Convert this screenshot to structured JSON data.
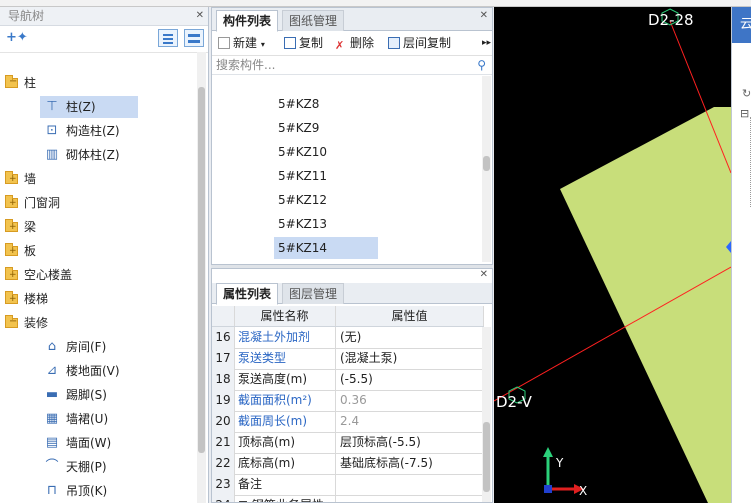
{
  "nav": {
    "title": "导航树",
    "add_icon": "plus-star-icon",
    "items": [
      {
        "label": "柱",
        "type": "folder-open"
      },
      {
        "label": "柱(Z)",
        "type": "child",
        "icon": "column-icon",
        "selected": true
      },
      {
        "label": "构造柱(Z)",
        "type": "child",
        "icon": "constructional-column-icon"
      },
      {
        "label": "砌体柱(Z)",
        "type": "child",
        "icon": "masonry-column-icon"
      },
      {
        "label": "墙",
        "type": "folder"
      },
      {
        "label": "门窗洞",
        "type": "folder"
      },
      {
        "label": "梁",
        "type": "folder"
      },
      {
        "label": "板",
        "type": "folder"
      },
      {
        "label": "空心楼盖",
        "type": "folder"
      },
      {
        "label": "楼梯",
        "type": "folder"
      },
      {
        "label": "装修",
        "type": "folder-open"
      },
      {
        "label": "房间(F)",
        "type": "child",
        "icon": "room-icon"
      },
      {
        "label": "楼地面(V)",
        "type": "child",
        "icon": "floor-icon"
      },
      {
        "label": "踢脚(S)",
        "type": "child",
        "icon": "skirting-icon"
      },
      {
        "label": "墙裙(U)",
        "type": "child",
        "icon": "dado-icon"
      },
      {
        "label": "墙面(W)",
        "type": "child",
        "icon": "wall-face-icon"
      },
      {
        "label": "天棚(P)",
        "type": "child",
        "icon": "ceiling-icon"
      },
      {
        "label": "吊顶(K)",
        "type": "child",
        "icon": "suspended-ceiling-icon"
      }
    ]
  },
  "components": {
    "tabs": [
      "构件列表",
      "图纸管理"
    ],
    "toolbar": {
      "new": "新建",
      "copy": "复制",
      "delete": "删除",
      "floor_copy": "层间复制"
    },
    "search_placeholder": "搜索构件...",
    "items": [
      "5#KZ8",
      "5#KZ9",
      "5#KZ10",
      "5#KZ11",
      "5#KZ12",
      "5#KZ13",
      "5#KZ14"
    ],
    "selected_index": 6
  },
  "properties": {
    "tabs": [
      "属性列表",
      "图层管理"
    ],
    "headers": {
      "name": "属性名称",
      "value": "属性值"
    },
    "rows": [
      {
        "num": "16",
        "name": "混凝土外加剂",
        "value": "(无)",
        "style": "blue"
      },
      {
        "num": "17",
        "name": "泵送类型",
        "value": "(混凝土泵)",
        "style": "blue"
      },
      {
        "num": "18",
        "name": "泵送高度(m)",
        "value": "(-5.5)",
        "style": "normal"
      },
      {
        "num": "19",
        "name": "截面面积(m²)",
        "value": "0.36",
        "style": "grey"
      },
      {
        "num": "20",
        "name": "截面周长(m)",
        "value": "2.4",
        "style": "grey"
      },
      {
        "num": "21",
        "name": "顶标高(m)",
        "value": "层顶标高(-5.5)",
        "style": "normal"
      },
      {
        "num": "22",
        "name": "底标高(m)",
        "value": "基础底标高(-7.5)",
        "style": "normal"
      },
      {
        "num": "23",
        "name": "备注",
        "value": "",
        "style": "normal"
      },
      {
        "num": "24",
        "name": "⊞ 钢筋业务属性",
        "value": "",
        "style": "normal"
      }
    ]
  },
  "canvas": {
    "axis_top": "D2-28",
    "axis_left": "D2-V",
    "axis_x": "X",
    "axis_y": "Y",
    "fill_color": "#c8de7a",
    "line_color": "#ff2020"
  },
  "right_panel": {
    "title": "云",
    "collapse": "⊟"
  }
}
